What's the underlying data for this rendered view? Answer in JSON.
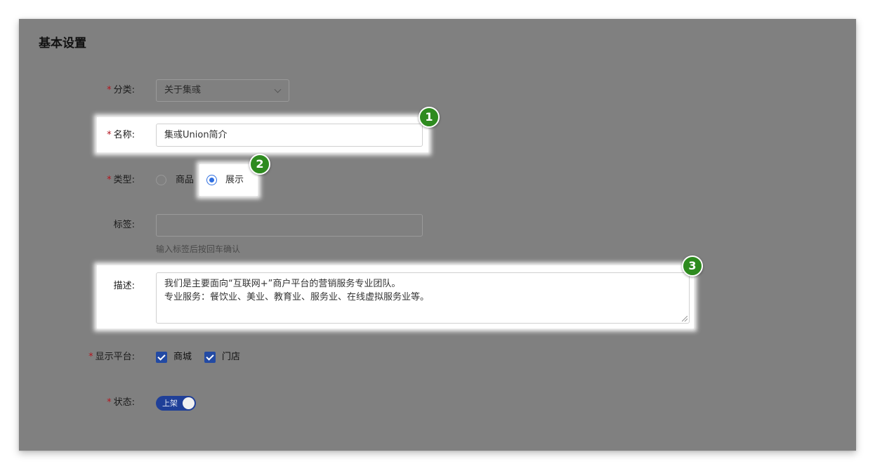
{
  "section": {
    "title": "基本设置"
  },
  "form": {
    "category": {
      "label": "分类:",
      "required_mark": "*",
      "value": "关于集彧"
    },
    "name": {
      "label": "名称:",
      "required_mark": "*",
      "value": "集彧Union简介"
    },
    "type": {
      "label": "类型:",
      "required_mark": "*",
      "options": [
        "商品",
        "展示"
      ],
      "selected": "展示"
    },
    "tags": {
      "label": "标签:",
      "value": "",
      "hint": "输入标签后按回车确认"
    },
    "description": {
      "label": "描述:",
      "line1": "我们是主要面向“互联网+”商户平台的营销服务专业团队。",
      "line2": "专业服务：餐饮业、美业、教育业、服务业、在线虚拟服务业等。"
    },
    "platform": {
      "label": "显示平台:",
      "required_mark": "*",
      "options": [
        {
          "label": "商城",
          "checked": true
        },
        {
          "label": "门店",
          "checked": true
        }
      ]
    },
    "status": {
      "label": "状态:",
      "required_mark": "*",
      "switch_text": "上架",
      "on": true
    }
  },
  "annotations": {
    "badge1": "1",
    "badge2": "2",
    "badge3": "3",
    "badge_color": "#2e8b1f"
  },
  "colors": {
    "overlay": "#808080",
    "accent": "#2f6fe0",
    "required": "#b4141e"
  }
}
